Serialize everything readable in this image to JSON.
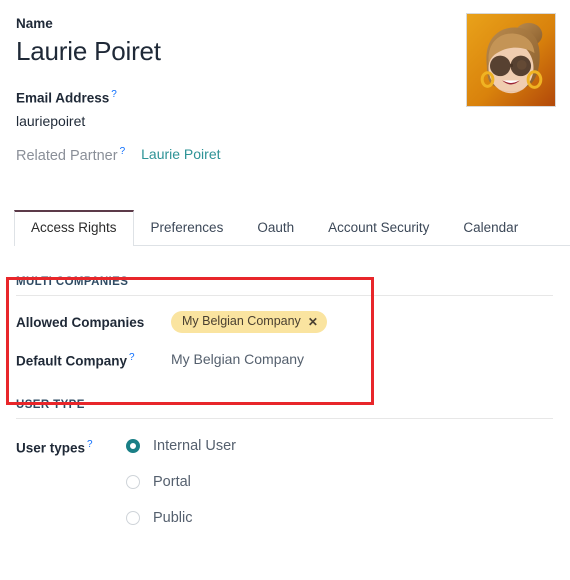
{
  "header": {
    "name_label": "Name",
    "name_value": "Laurie Poiret",
    "email_label": "Email Address",
    "email_value": "lauriepoiret",
    "partner_label": "Related Partner",
    "partner_link": "Laurie Poiret",
    "help_mark": "?",
    "avatar_name": "user-avatar"
  },
  "tabs": [
    {
      "label": "Access Rights",
      "active": true
    },
    {
      "label": "Preferences",
      "active": false
    },
    {
      "label": "Oauth",
      "active": false
    },
    {
      "label": "Account Security",
      "active": false
    },
    {
      "label": "Calendar",
      "active": false
    }
  ],
  "multi_companies": {
    "section_title": "Multi Companies",
    "allowed_label": "Allowed Companies",
    "allowed_tag": "My Belgian Company",
    "tag_remove_icon": "✕",
    "default_label": "Default Company",
    "default_value": "My Belgian Company"
  },
  "user_type": {
    "section_title": "User Type",
    "field_label": "User types",
    "options": [
      {
        "label": "Internal User",
        "selected": true
      },
      {
        "label": "Portal",
        "selected": false
      },
      {
        "label": "Public",
        "selected": false
      }
    ]
  },
  "colors": {
    "link": "#2e9396",
    "radio_selected": "#1a7f86",
    "tag_bg": "#fae4a0",
    "active_tab_border": "#5c3a49",
    "highlight": "#e8262a",
    "help_mark": "#0d6efd",
    "section_title": "#2f4b63"
  }
}
